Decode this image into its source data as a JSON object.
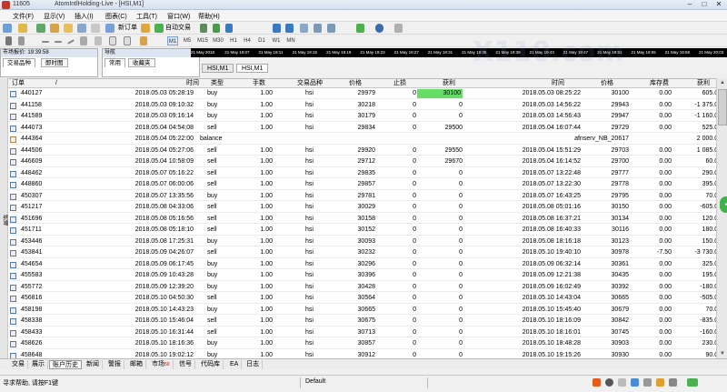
{
  "window": {
    "app_number": "11605",
    "title": "AtomIntlHolding-Live - [HSI,M1]",
    "controls": [
      "–",
      "□",
      "✕"
    ]
  },
  "menu": [
    "文件(F)",
    "显示(V)",
    "插入(I)",
    "图表(C)",
    "工具(T)",
    "窗口(W)",
    "帮助(H)"
  ],
  "toolbar": {
    "new_order": "新订单",
    "auto_trade": "自动交易",
    "timeframes": [
      "M1",
      "M5",
      "M15",
      "M30",
      "H1",
      "H4",
      "D1",
      "W1",
      "MN"
    ],
    "active_timeframe": "M1"
  },
  "time_scale": [
    "21 May 2018",
    "21 May 19:07",
    "21 May 19:11",
    "21 May 19:15",
    "21 May 19:19",
    "21 May 19:23",
    "21 May 19:27",
    "21 May 19:31",
    "21 May 19:35",
    "21 May 19:39",
    "21 May 19:43",
    "21 May 19:47",
    "21 May 19:51",
    "21 May 19:55",
    "21 May 19:59",
    "21 May 20:03"
  ],
  "market_watch": {
    "title": "市场报价: 19:39:58",
    "tabs": [
      "交易品种",
      "即时图"
    ]
  },
  "navigator": {
    "title": "导航",
    "tabs": [
      "常用",
      "收藏夹"
    ]
  },
  "chart_tabs": [
    "HSI,M1",
    "HSI,M1"
  ],
  "table": {
    "headers": {
      "order": "订单",
      "sort": "/",
      "time": "时间",
      "type": "类型",
      "size": "手数",
      "symbol": "交易品种",
      "price": "价格",
      "sl": "止损",
      "tp": "获利",
      "close_time": "时间",
      "close_price": "价格",
      "swap": "库存费",
      "profit": "获利"
    },
    "rows": [
      {
        "order": "440127",
        "time": "2018.05.03 05:28:19",
        "type": "buy",
        "size": "1.00",
        "symbol": "hsi",
        "price": "29979",
        "sl": "0",
        "tp": "30100",
        "close_time": "2018.05.03 08:25:22",
        "close_price": "30100",
        "swap": "0.00",
        "profit": "605.00",
        "tp_hit": true
      },
      {
        "order": "441158",
        "time": "2018.05.03 09:10:32",
        "type": "buy",
        "size": "1.00",
        "symbol": "hsi",
        "price": "30218",
        "sl": "0",
        "tp": "0",
        "close_time": "2018.05.03 14:56:22",
        "close_price": "29943",
        "swap": "0.00",
        "profit": "-1 375.00"
      },
      {
        "order": "441589",
        "time": "2018.05.03 09:16:14",
        "type": "buy",
        "size": "1.00",
        "symbol": "hsi",
        "price": "30179",
        "sl": "0",
        "tp": "0",
        "close_time": "2018.05.03 14:56:43",
        "close_price": "29947",
        "swap": "0.00",
        "profit": "-1 160.00"
      },
      {
        "order": "444073",
        "time": "2018.05.04 04:54:08",
        "type": "sell",
        "size": "1.00",
        "symbol": "hsi",
        "price": "29834",
        "sl": "0",
        "tp": "29500",
        "close_time": "2018.05.04 16:07:44",
        "close_price": "29729",
        "swap": "0.00",
        "profit": "525.00"
      },
      {
        "order": "444364",
        "time": "2018.05.04 05:22:00",
        "type": "balance",
        "size": "",
        "symbol": "",
        "price": "",
        "sl": "",
        "tp": "",
        "close_time": "",
        "close_price": "afnserv_NB_20617",
        "swap": "",
        "profit": "2 000.00",
        "balance": true
      },
      {
        "order": "444506",
        "time": "2018.05.04 05:27:06",
        "type": "sell",
        "size": "1.00",
        "symbol": "hsi",
        "price": "29920",
        "sl": "0",
        "tp": "29550",
        "close_time": "2018.05.04 15:51:29",
        "close_price": "29703",
        "swap": "0.00",
        "profit": "1 085.00"
      },
      {
        "order": "446609",
        "time": "2018.05.04 10:58:09",
        "type": "sell",
        "size": "1.00",
        "symbol": "hsi",
        "price": "29712",
        "sl": "0",
        "tp": "29670",
        "close_time": "2018.05.04 16:14:52",
        "close_price": "29700",
        "swap": "0.00",
        "profit": "60.00"
      },
      {
        "order": "448462",
        "time": "2018.05.07 05:16:22",
        "type": "sell",
        "size": "1.00",
        "symbol": "hsi",
        "price": "29835",
        "sl": "0",
        "tp": "0",
        "close_time": "2018.05.07 13:22:48",
        "close_price": "29777",
        "swap": "0.00",
        "profit": "290.00"
      },
      {
        "order": "448860",
        "time": "2018.05.07 06:00:06",
        "type": "sell",
        "size": "1.00",
        "symbol": "hsi",
        "price": "29857",
        "sl": "0",
        "tp": "0",
        "close_time": "2018.05.07 13:22:30",
        "close_price": "29778",
        "swap": "0.00",
        "profit": "395.00"
      },
      {
        "order": "450307",
        "time": "2018.05.07 13:35:56",
        "type": "buy",
        "size": "1.00",
        "symbol": "hsi",
        "price": "29781",
        "sl": "0",
        "tp": "0",
        "close_time": "2018.05.07 16:43:25",
        "close_price": "29795",
        "swap": "0.00",
        "profit": "70.00"
      },
      {
        "order": "451217",
        "time": "2018.05.08 04:33:06",
        "type": "sell",
        "size": "1.00",
        "symbol": "hsi",
        "price": "30029",
        "sl": "0",
        "tp": "0",
        "close_time": "2018.05.08 05:01:16",
        "close_price": "30150",
        "swap": "0.00",
        "profit": "-605.00"
      },
      {
        "order": "451696",
        "time": "2018.05.08 05:16:56",
        "type": "sell",
        "size": "1.00",
        "symbol": "hsi",
        "price": "30158",
        "sl": "0",
        "tp": "0",
        "close_time": "2018.05.08 16:37:21",
        "close_price": "30134",
        "swap": "0.00",
        "profit": "120.00"
      },
      {
        "order": "451711",
        "time": "2018.05.08 05:18:10",
        "type": "sell",
        "size": "1.00",
        "symbol": "hsi",
        "price": "30152",
        "sl": "0",
        "tp": "0",
        "close_time": "2018.05.08 16:40:33",
        "close_price": "30116",
        "swap": "0.00",
        "profit": "180.00"
      },
      {
        "order": "453446",
        "time": "2018.05.08 17:25:31",
        "type": "buy",
        "size": "1.00",
        "symbol": "hsi",
        "price": "30093",
        "sl": "0",
        "tp": "0",
        "close_time": "2018.05.08 18:16:18",
        "close_price": "30123",
        "swap": "0.00",
        "profit": "150.00"
      },
      {
        "order": "453841",
        "time": "2018.05.09 04:26:07",
        "type": "sell",
        "size": "1.00",
        "symbol": "hsi",
        "price": "30232",
        "sl": "0",
        "tp": "0",
        "close_time": "2018.05.10 19:40:10",
        "close_price": "30978",
        "swap": "-7.50",
        "profit": "-3 730.00"
      },
      {
        "order": "454654",
        "time": "2018.05.09 06:17:45",
        "type": "buy",
        "size": "1.00",
        "symbol": "hsi",
        "price": "30296",
        "sl": "0",
        "tp": "0",
        "close_time": "2018.05.09 06:32:14",
        "close_price": "30361",
        "swap": "0.00",
        "profit": "325.00"
      },
      {
        "order": "455583",
        "time": "2018.05.09 10:43:28",
        "type": "buy",
        "size": "1.00",
        "symbol": "hsi",
        "price": "30396",
        "sl": "0",
        "tp": "0",
        "close_time": "2018.05.09 12:21:38",
        "close_price": "30435",
        "swap": "0.00",
        "profit": "195.00"
      },
      {
        "order": "455772",
        "time": "2018.05.09 12:39:20",
        "type": "buy",
        "size": "1.00",
        "symbol": "hsi",
        "price": "30428",
        "sl": "0",
        "tp": "0",
        "close_time": "2018.05.09 16:02:49",
        "close_price": "30392",
        "swap": "0.00",
        "profit": "-180.00"
      },
      {
        "order": "456816",
        "time": "2018.05.10 04:50:30",
        "type": "sell",
        "size": "1.00",
        "symbol": "hsi",
        "price": "30564",
        "sl": "0",
        "tp": "0",
        "close_time": "2018.05.10 14:43:04",
        "close_price": "30665",
        "swap": "0.00",
        "profit": "-505.00"
      },
      {
        "order": "458198",
        "time": "2018.05.10 14:43:23",
        "type": "buy",
        "size": "1.00",
        "symbol": "hsi",
        "price": "30665",
        "sl": "0",
        "tp": "0",
        "close_time": "2018.05.10 15:45:40",
        "close_price": "30679",
        "swap": "0.00",
        "profit": "70.00"
      },
      {
        "order": "458338",
        "time": "2018.05.10 15:46:04",
        "type": "sell",
        "size": "1.00",
        "symbol": "hsi",
        "price": "30675",
        "sl": "0",
        "tp": "0",
        "close_time": "2018.05.10 18:16:09",
        "close_price": "30842",
        "swap": "0.00",
        "profit": "-835.00"
      },
      {
        "order": "458433",
        "time": "2018.05.10 16:31:44",
        "type": "sell",
        "size": "1.00",
        "symbol": "hsi",
        "price": "30713",
        "sl": "0",
        "tp": "0",
        "close_time": "2018.05.10 18:16:01",
        "close_price": "30745",
        "swap": "0.00",
        "profit": "-160.00"
      },
      {
        "order": "458626",
        "time": "2018.05.10 18:16:36",
        "type": "buy",
        "size": "1.00",
        "symbol": "hsi",
        "price": "30857",
        "sl": "0",
        "tp": "0",
        "close_time": "2018.05.10 18:48:28",
        "close_price": "30903",
        "swap": "0.00",
        "profit": "230.00"
      },
      {
        "order": "458648",
        "time": "2018.05.10 19:02:12",
        "type": "buy",
        "size": "1.00",
        "symbol": "hsi",
        "price": "30912",
        "sl": "0",
        "tp": "0",
        "close_time": "2018.05.10 19:15:26",
        "close_price": "30930",
        "swap": "0.00",
        "profit": "90.00"
      }
    ]
  },
  "bottom_tabs": [
    {
      "label": "交易"
    },
    {
      "label": "展示"
    },
    {
      "label": "账户历史",
      "selected": true
    },
    {
      "label": "新闻"
    },
    {
      "label": "警报"
    },
    {
      "label": "邮箱"
    },
    {
      "label": "市场",
      "badge": "50"
    },
    {
      "label": "信号"
    },
    {
      "label": "代码库"
    },
    {
      "label": "EA"
    },
    {
      "label": "日志"
    }
  ],
  "side_tab_label": "终端",
  "status": {
    "help": "寻求帮助, 请按F1键",
    "profile": "Default"
  },
  "colors": {
    "tp_highlight": "#66dd66",
    "timescale_bg": "#000000"
  }
}
